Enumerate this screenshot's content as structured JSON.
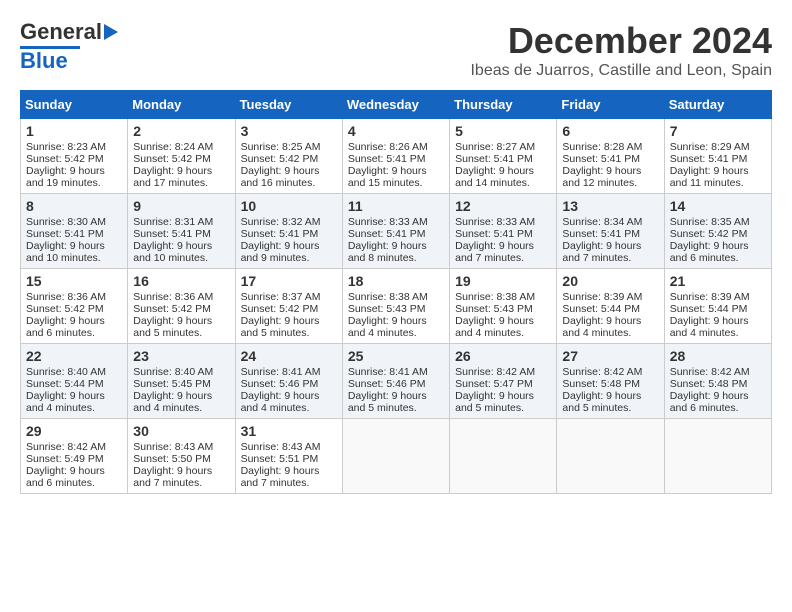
{
  "header": {
    "logo_general": "General",
    "logo_blue": "Blue",
    "month": "December 2024",
    "location": "Ibeas de Juarros, Castille and Leon, Spain"
  },
  "days_of_week": [
    "Sunday",
    "Monday",
    "Tuesday",
    "Wednesday",
    "Thursday",
    "Friday",
    "Saturday"
  ],
  "weeks": [
    [
      {
        "day": 1,
        "info": "Sunrise: 8:23 AM\nSunset: 5:42 PM\nDaylight: 9 hours and 19 minutes."
      },
      {
        "day": 2,
        "info": "Sunrise: 8:24 AM\nSunset: 5:42 PM\nDaylight: 9 hours and 17 minutes."
      },
      {
        "day": 3,
        "info": "Sunrise: 8:25 AM\nSunset: 5:42 PM\nDaylight: 9 hours and 16 minutes."
      },
      {
        "day": 4,
        "info": "Sunrise: 8:26 AM\nSunset: 5:41 PM\nDaylight: 9 hours and 15 minutes."
      },
      {
        "day": 5,
        "info": "Sunrise: 8:27 AM\nSunset: 5:41 PM\nDaylight: 9 hours and 14 minutes."
      },
      {
        "day": 6,
        "info": "Sunrise: 8:28 AM\nSunset: 5:41 PM\nDaylight: 9 hours and 12 minutes."
      },
      {
        "day": 7,
        "info": "Sunrise: 8:29 AM\nSunset: 5:41 PM\nDaylight: 9 hours and 11 minutes."
      }
    ],
    [
      {
        "day": 8,
        "info": "Sunrise: 8:30 AM\nSunset: 5:41 PM\nDaylight: 9 hours and 10 minutes."
      },
      {
        "day": 9,
        "info": "Sunrise: 8:31 AM\nSunset: 5:41 PM\nDaylight: 9 hours and 10 minutes."
      },
      {
        "day": 10,
        "info": "Sunrise: 8:32 AM\nSunset: 5:41 PM\nDaylight: 9 hours and 9 minutes."
      },
      {
        "day": 11,
        "info": "Sunrise: 8:33 AM\nSunset: 5:41 PM\nDaylight: 9 hours and 8 minutes."
      },
      {
        "day": 12,
        "info": "Sunrise: 8:33 AM\nSunset: 5:41 PM\nDaylight: 9 hours and 7 minutes."
      },
      {
        "day": 13,
        "info": "Sunrise: 8:34 AM\nSunset: 5:41 PM\nDaylight: 9 hours and 7 minutes."
      },
      {
        "day": 14,
        "info": "Sunrise: 8:35 AM\nSunset: 5:42 PM\nDaylight: 9 hours and 6 minutes."
      }
    ],
    [
      {
        "day": 15,
        "info": "Sunrise: 8:36 AM\nSunset: 5:42 PM\nDaylight: 9 hours and 6 minutes."
      },
      {
        "day": 16,
        "info": "Sunrise: 8:36 AM\nSunset: 5:42 PM\nDaylight: 9 hours and 5 minutes."
      },
      {
        "day": 17,
        "info": "Sunrise: 8:37 AM\nSunset: 5:42 PM\nDaylight: 9 hours and 5 minutes."
      },
      {
        "day": 18,
        "info": "Sunrise: 8:38 AM\nSunset: 5:43 PM\nDaylight: 9 hours and 4 minutes."
      },
      {
        "day": 19,
        "info": "Sunrise: 8:38 AM\nSunset: 5:43 PM\nDaylight: 9 hours and 4 minutes."
      },
      {
        "day": 20,
        "info": "Sunrise: 8:39 AM\nSunset: 5:44 PM\nDaylight: 9 hours and 4 minutes."
      },
      {
        "day": 21,
        "info": "Sunrise: 8:39 AM\nSunset: 5:44 PM\nDaylight: 9 hours and 4 minutes."
      }
    ],
    [
      {
        "day": 22,
        "info": "Sunrise: 8:40 AM\nSunset: 5:44 PM\nDaylight: 9 hours and 4 minutes."
      },
      {
        "day": 23,
        "info": "Sunrise: 8:40 AM\nSunset: 5:45 PM\nDaylight: 9 hours and 4 minutes."
      },
      {
        "day": 24,
        "info": "Sunrise: 8:41 AM\nSunset: 5:46 PM\nDaylight: 9 hours and 4 minutes."
      },
      {
        "day": 25,
        "info": "Sunrise: 8:41 AM\nSunset: 5:46 PM\nDaylight: 9 hours and 5 minutes."
      },
      {
        "day": 26,
        "info": "Sunrise: 8:42 AM\nSunset: 5:47 PM\nDaylight: 9 hours and 5 minutes."
      },
      {
        "day": 27,
        "info": "Sunrise: 8:42 AM\nSunset: 5:48 PM\nDaylight: 9 hours and 5 minutes."
      },
      {
        "day": 28,
        "info": "Sunrise: 8:42 AM\nSunset: 5:48 PM\nDaylight: 9 hours and 6 minutes."
      }
    ],
    [
      {
        "day": 29,
        "info": "Sunrise: 8:42 AM\nSunset: 5:49 PM\nDaylight: 9 hours and 6 minutes."
      },
      {
        "day": 30,
        "info": "Sunrise: 8:43 AM\nSunset: 5:50 PM\nDaylight: 9 hours and 7 minutes."
      },
      {
        "day": 31,
        "info": "Sunrise: 8:43 AM\nSunset: 5:51 PM\nDaylight: 9 hours and 7 minutes."
      },
      null,
      null,
      null,
      null
    ]
  ]
}
